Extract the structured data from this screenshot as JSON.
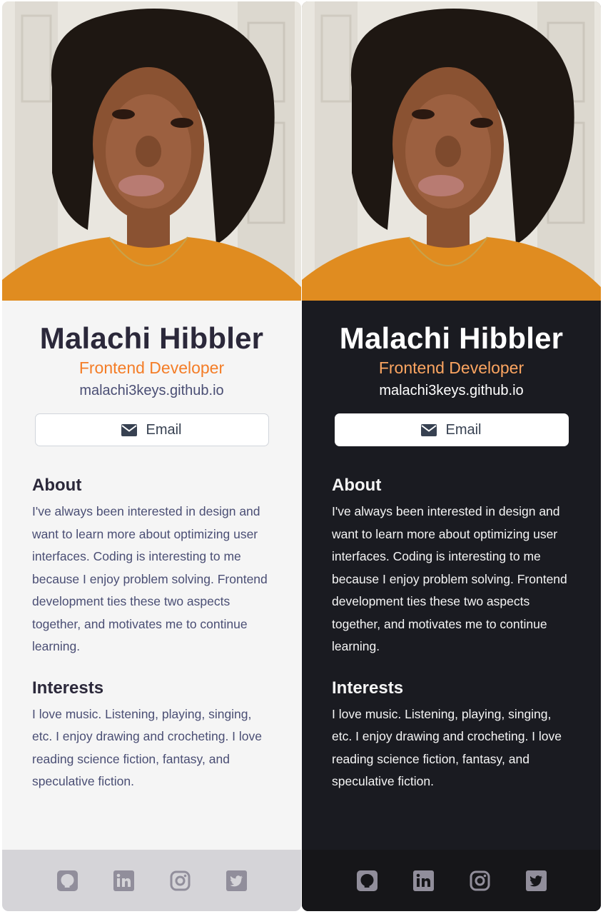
{
  "profile": {
    "name": "Malachi Hibbler",
    "title": "Frontend Developer",
    "website": "malachi3keys.github.io",
    "email_label": "Email",
    "about_heading": "About",
    "about_text": "I've always been interested in design and want to learn more about optimizing user interfaces. Coding is interesting to me because I enjoy problem solving. Frontend development ties these two aspects together, and motivates me to continue learning.",
    "interests_heading": "Interests",
    "interests_text": "I love music. Listening, playing, singing, etc. I enjoy drawing and crocheting. I love reading science fiction, fantasy, and speculative fiction."
  },
  "social_icons": [
    "github-icon",
    "linkedin-icon",
    "instagram-icon",
    "twitter-icon"
  ],
  "themes": {
    "light": {
      "background": "#f5f5f5",
      "name": "#2b283a",
      "title": "#f47d27",
      "text": "#4a4e74",
      "footer": "#d5d4d8",
      "icon": "#918e9b"
    },
    "dark": {
      "background": "#1a1b21",
      "name": "#ffffff",
      "title": "#fca561",
      "text": "#f5f5f5",
      "footer": "#161619",
      "icon": "#918e9b"
    }
  }
}
